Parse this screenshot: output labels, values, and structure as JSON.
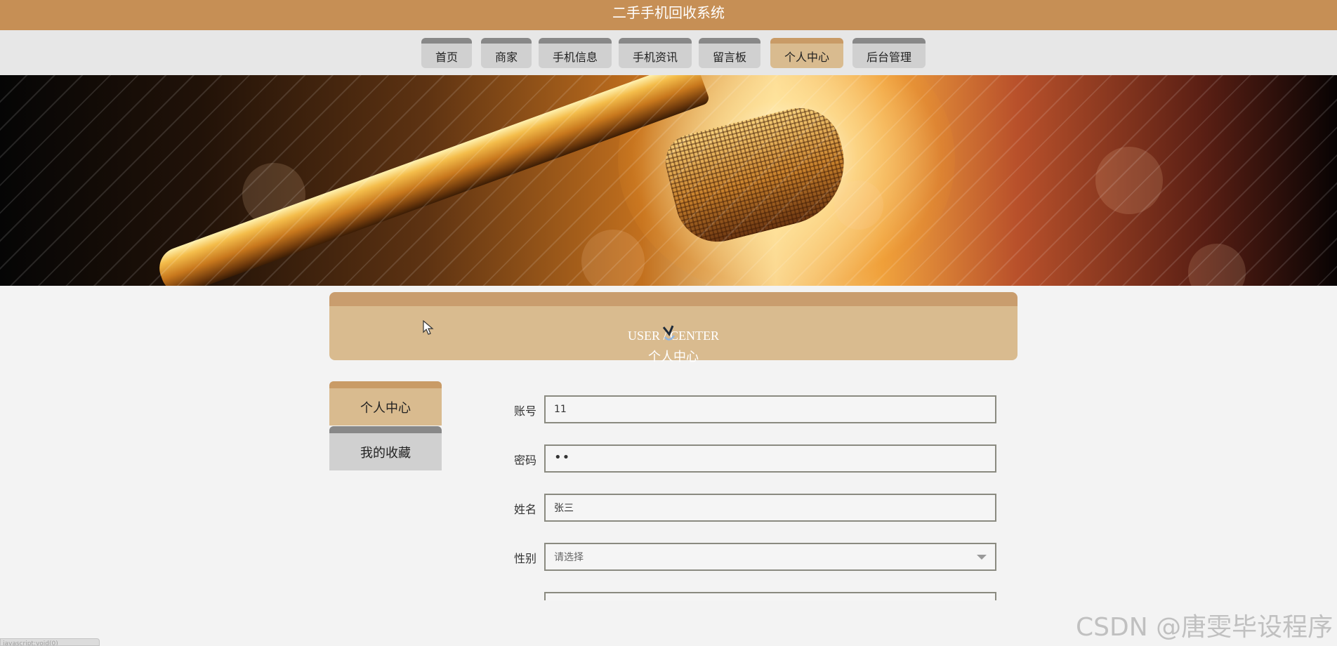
{
  "site": {
    "title": "二手手机回收系统"
  },
  "nav": {
    "items": [
      {
        "label": "首页"
      },
      {
        "label": "商家"
      },
      {
        "label": "手机信息"
      },
      {
        "label": "手机资讯"
      },
      {
        "label": "留言板"
      },
      {
        "label": "个人中心",
        "active": true
      },
      {
        "label": "后台管理"
      }
    ]
  },
  "section": {
    "title_en": "USER / CENTER",
    "title_cn": "个人中心"
  },
  "sidebar": {
    "items": [
      {
        "label": "个人中心",
        "active": true
      },
      {
        "label": "我的收藏"
      }
    ]
  },
  "form": {
    "account": {
      "label": "账号",
      "value": "11"
    },
    "password": {
      "label": "密码",
      "value": "••"
    },
    "name": {
      "label": "姓名",
      "value": "张三"
    },
    "gender": {
      "label": "性别",
      "value": "请选择"
    }
  },
  "watermark": "CSDN @唐雯毕设程序",
  "status": {
    "url": "javascript:void(0)"
  },
  "colors": {
    "accent": "#c68f55",
    "tab_active": "#d9bb8f",
    "tab_inactive": "#d0d0d0",
    "page_background": "#f3f3f3"
  }
}
